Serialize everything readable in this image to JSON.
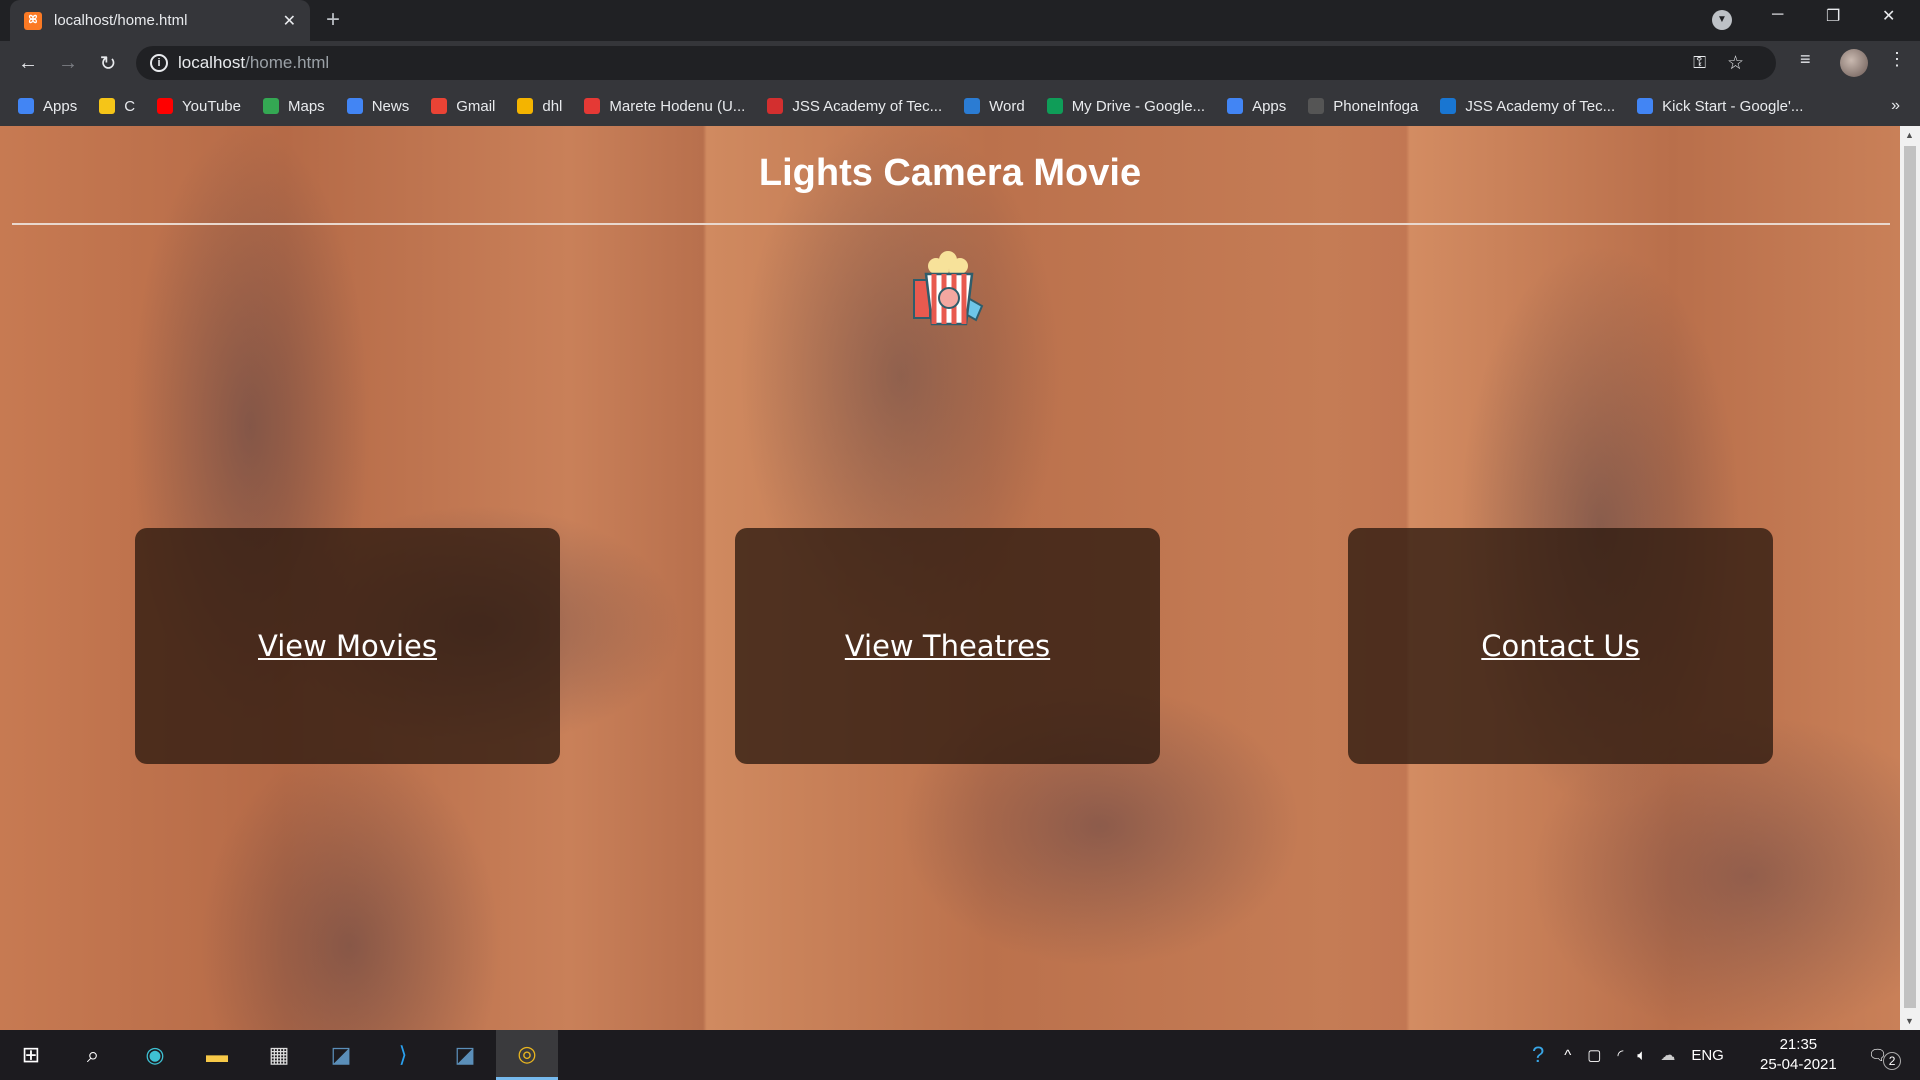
{
  "browser": {
    "tab_title": "localhost/home.html",
    "url_host": "localhost",
    "url_path": "/home.html",
    "bookmarks": [
      {
        "label": "Apps",
        "color": "#4285f4"
      },
      {
        "label": "C",
        "color": "#f5c518"
      },
      {
        "label": "YouTube",
        "color": "#ff0000"
      },
      {
        "label": "Maps",
        "color": "#34a853"
      },
      {
        "label": "News",
        "color": "#4285f4"
      },
      {
        "label": "Gmail",
        "color": "#ea4335"
      },
      {
        "label": "dhl",
        "color": "#f4b400"
      },
      {
        "label": "Marete Hodenu (U...",
        "color": "#e53935"
      },
      {
        "label": "JSS Academy of Tec...",
        "color": "#d32f2f"
      },
      {
        "label": "Word",
        "color": "#2b7cd3"
      },
      {
        "label": "My Drive - Google...",
        "color": "#0f9d58"
      },
      {
        "label": "Apps",
        "color": "#4285f4"
      },
      {
        "label": "PhoneInfoga",
        "color": "#555555"
      },
      {
        "label": "JSS Academy of Tec...",
        "color": "#1976d2"
      },
      {
        "label": "Kick Start - Google'...",
        "color": "#4285f4"
      }
    ]
  },
  "page": {
    "title": "Lights Camera Movie",
    "cards": [
      {
        "label": "View Movies"
      },
      {
        "label": "View Theatres"
      },
      {
        "label": "Contact Us"
      }
    ]
  },
  "taskbar": {
    "language": "ENG",
    "time": "21:35",
    "date": "25-04-2021",
    "notification_count": "2"
  }
}
